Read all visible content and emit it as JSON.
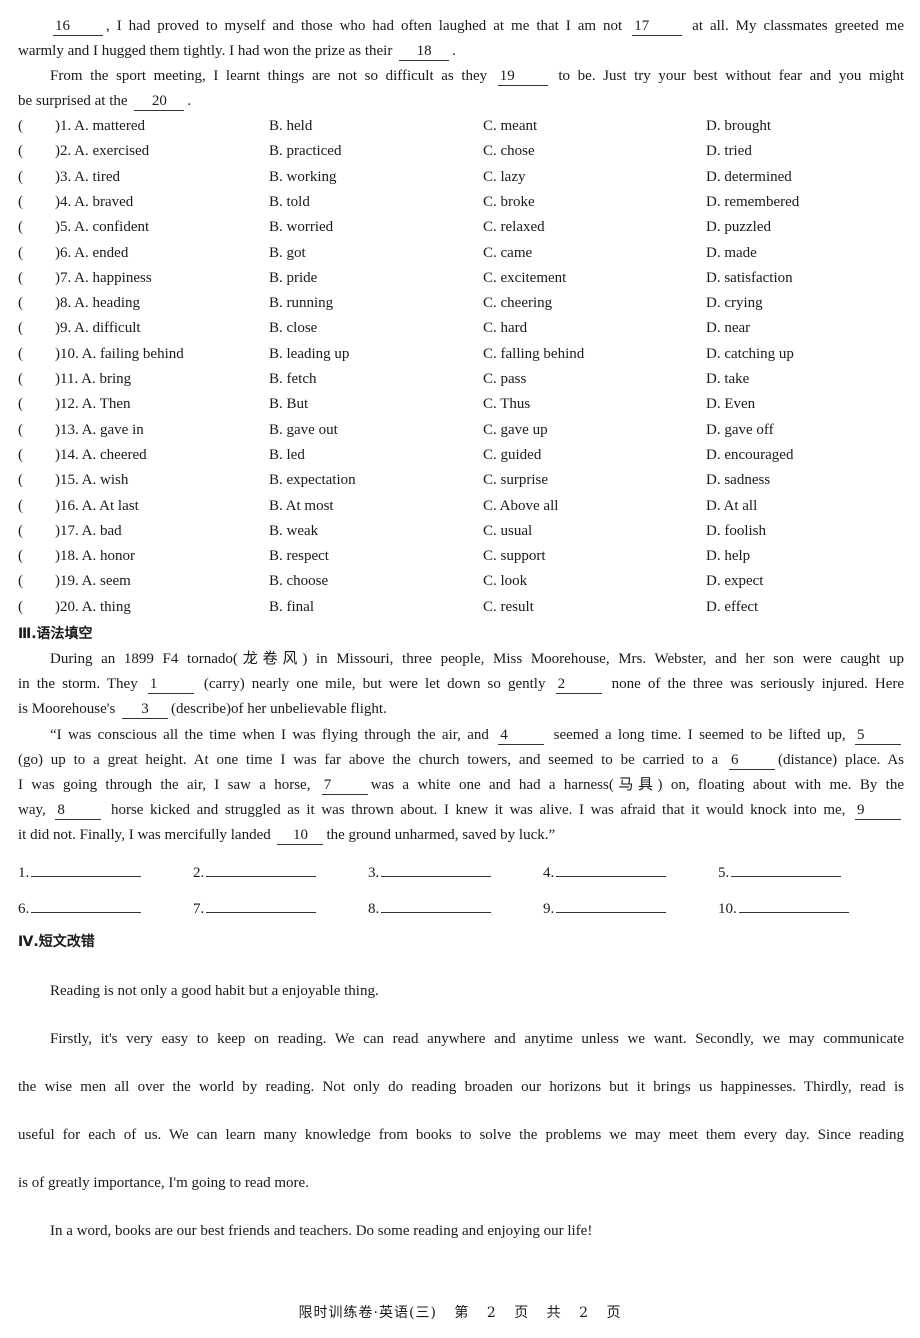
{
  "cloze_passage_tail": {
    "line1_parts": [
      "",
      ", I had proved to myself and those who had often laughed at me that I am not",
      "at all.  My classmates greeted me"
    ],
    "line1_blanks": [
      "16",
      "17"
    ],
    "line2_parts": [
      "warmly and I hugged them tightly.  I had won the prize as their",
      "."
    ],
    "line2_blanks": [
      "18"
    ],
    "line3_parts": [
      "From the sport meeting, I learnt things are not so difficult as they",
      "to be.  Just try your best without fear and you might"
    ],
    "line3_blanks": [
      "19"
    ],
    "line4_parts": [
      "be surprised at the",
      "."
    ],
    "line4_blanks": [
      "20"
    ]
  },
  "cloze_questions": [
    {
      "num": "1",
      "A": "mattered",
      "B": "held",
      "C": "meant",
      "D": "brought"
    },
    {
      "num": "2",
      "A": "exercised",
      "B": "practiced",
      "C": "chose",
      "D": "tried"
    },
    {
      "num": "3",
      "A": "tired",
      "B": "working",
      "C": "lazy",
      "D": "determined"
    },
    {
      "num": "4",
      "A": "braved",
      "B": "told",
      "C": "broke",
      "D": "remembered"
    },
    {
      "num": "5",
      "A": "confident",
      "B": "worried",
      "C": "relaxed",
      "D": "puzzled"
    },
    {
      "num": "6",
      "A": "ended",
      "B": "got",
      "C": "came",
      "D": "made"
    },
    {
      "num": "7",
      "A": "happiness",
      "B": "pride",
      "C": "excitement",
      "D": "satisfaction"
    },
    {
      "num": "8",
      "A": "heading",
      "B": "running",
      "C": "cheering",
      "D": "crying"
    },
    {
      "num": "9",
      "A": "difficult",
      "B": "close",
      "C": "hard",
      "D": "near"
    },
    {
      "num": "10",
      "A": "failing behind",
      "B": "leading up",
      "C": "falling behind",
      "D": "catching up"
    },
    {
      "num": "11",
      "A": "bring",
      "B": "fetch",
      "C": "pass",
      "D": "take"
    },
    {
      "num": "12",
      "A": "Then",
      "B": "But",
      "C": "Thus",
      "D": "Even"
    },
    {
      "num": "13",
      "A": "gave in",
      "B": "gave out",
      "C": "gave up",
      "D": "gave off"
    },
    {
      "num": "14",
      "A": "cheered",
      "B": "led",
      "C": "guided",
      "D": "encouraged"
    },
    {
      "num": "15",
      "A": "wish",
      "B": "expectation",
      "C": "surprise",
      "D": "sadness"
    },
    {
      "num": "16",
      "A": "At last",
      "B": "At most",
      "C": "Above all",
      "D": "At all"
    },
    {
      "num": "17",
      "A": "bad",
      "B": "weak",
      "C": "usual",
      "D": "foolish"
    },
    {
      "num": "18",
      "A": "honor",
      "B": "respect",
      "C": "support",
      "D": "help"
    },
    {
      "num": "19",
      "A": "seem",
      "B": "choose",
      "C": "look",
      "D": "expect"
    },
    {
      "num": "20",
      "A": "thing",
      "B": "final",
      "C": "result",
      "D": "effect"
    }
  ],
  "option_prefixes": {
    "paren_open": "(",
    "paren_close": ")",
    "A": "A.",
    "B": "B.",
    "C": "C.",
    "D": "D."
  },
  "section3": {
    "heading": "Ⅲ.语法填空",
    "p1_l1": "During an 1899 F4 tornado(龙卷风) in Missouri, three people, Miss Moorehouse, Mrs.  Webster, and her son were caught up",
    "p1_l2_parts": [
      "in the storm.  They",
      "(carry) nearly one mile, but were let down so gently",
      "none of the three was seriously injured.  Here"
    ],
    "p1_l2_blanks": [
      "1",
      "2"
    ],
    "p1_l3_parts": [
      "is Moorehouse's",
      "(describe)of her unbelievable flight."
    ],
    "p1_l3_blanks": [
      "3"
    ],
    "p2_l1_parts": [
      "“I was conscious all the time when I was flying through the air, and",
      "seemed a long time.  I seemed to be lifted up,",
      ""
    ],
    "p2_l1_blanks": [
      "4",
      "5"
    ],
    "p2_l2_parts": [
      "(go) up to a great height.  At one time I was far above the church towers, and seemed to be carried to a",
      "(distance) place.  As"
    ],
    "p2_l2_blanks": [
      "6"
    ],
    "p2_l3_parts": [
      "I was going through the air, I saw a horse,",
      "was a white one and had a harness(马具) on, floating about with me.  By the"
    ],
    "p2_l3_blanks": [
      "7"
    ],
    "p2_l4_parts": [
      "way,",
      "horse kicked and struggled as it was thrown about.  I knew it was alive.  I was afraid that it would knock into me,",
      ""
    ],
    "p2_l4_blanks": [
      "8",
      "9"
    ],
    "p2_l5_parts": [
      "it did not.  Finally, I was mercifully landed",
      "the ground unharmed, saved by luck.”"
    ],
    "p2_l5_blanks": [
      "10"
    ],
    "answer_labels": [
      "1.",
      "2.",
      "3.",
      "4.",
      "5.",
      "6.",
      "7.",
      "8.",
      "9.",
      "10."
    ]
  },
  "section4": {
    "heading": "Ⅳ.短文改错",
    "lines": [
      "Reading is not only a good habit but a enjoyable thing.",
      "Firstly, it's very easy to keep on reading.  We can read anywhere and anytime unless we want.  Secondly, we may communicate",
      "the wise men all over the world by reading.  Not only do reading broaden our horizons but it brings us happinesses.  Thirdly, read is",
      "useful for each of us.  We can learn many knowledge from books to solve the problems we may meet them every day.  Since reading",
      "is of greatly importance, I'm going to read more.",
      "In a word, books are our best friends and teachers.  Do some reading and enjoying our life!"
    ]
  },
  "footer": {
    "title": "限时训练卷·英语(三)",
    "page_label_pre": "第",
    "page_current": "2",
    "page_label_mid": "页",
    "total_label_pre": "共",
    "page_total": "2",
    "total_label_post": "页"
  }
}
